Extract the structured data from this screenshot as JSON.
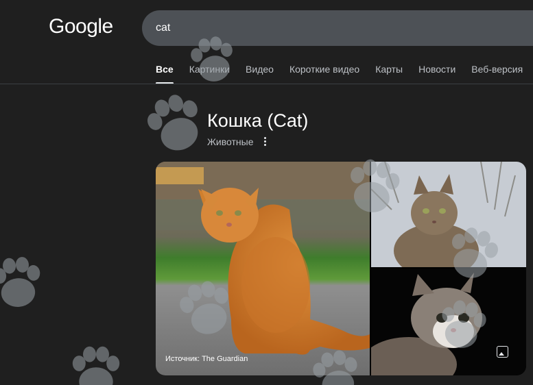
{
  "header": {
    "logo_text": "Google",
    "search_value": "cat"
  },
  "tabs": [
    {
      "label": "Все",
      "active": true
    },
    {
      "label": "Картинки"
    },
    {
      "label": "Видео"
    },
    {
      "label": "Короткие видео"
    },
    {
      "label": "Карты"
    },
    {
      "label": "Новости"
    },
    {
      "label": "Веб-версия"
    }
  ],
  "knowledge_panel": {
    "title": "Кошка (Cat)",
    "subtitle": "Животные",
    "more_icon": "more-vert-icon",
    "image_caption": "Источник: The Guardian",
    "image_icon": "image-icon"
  },
  "colors": {
    "background": "#1f1f1f",
    "search_bg": "#4d5156",
    "tab_inactive": "#bdc1c6",
    "paw_overlay": "#9aa0a6"
  }
}
